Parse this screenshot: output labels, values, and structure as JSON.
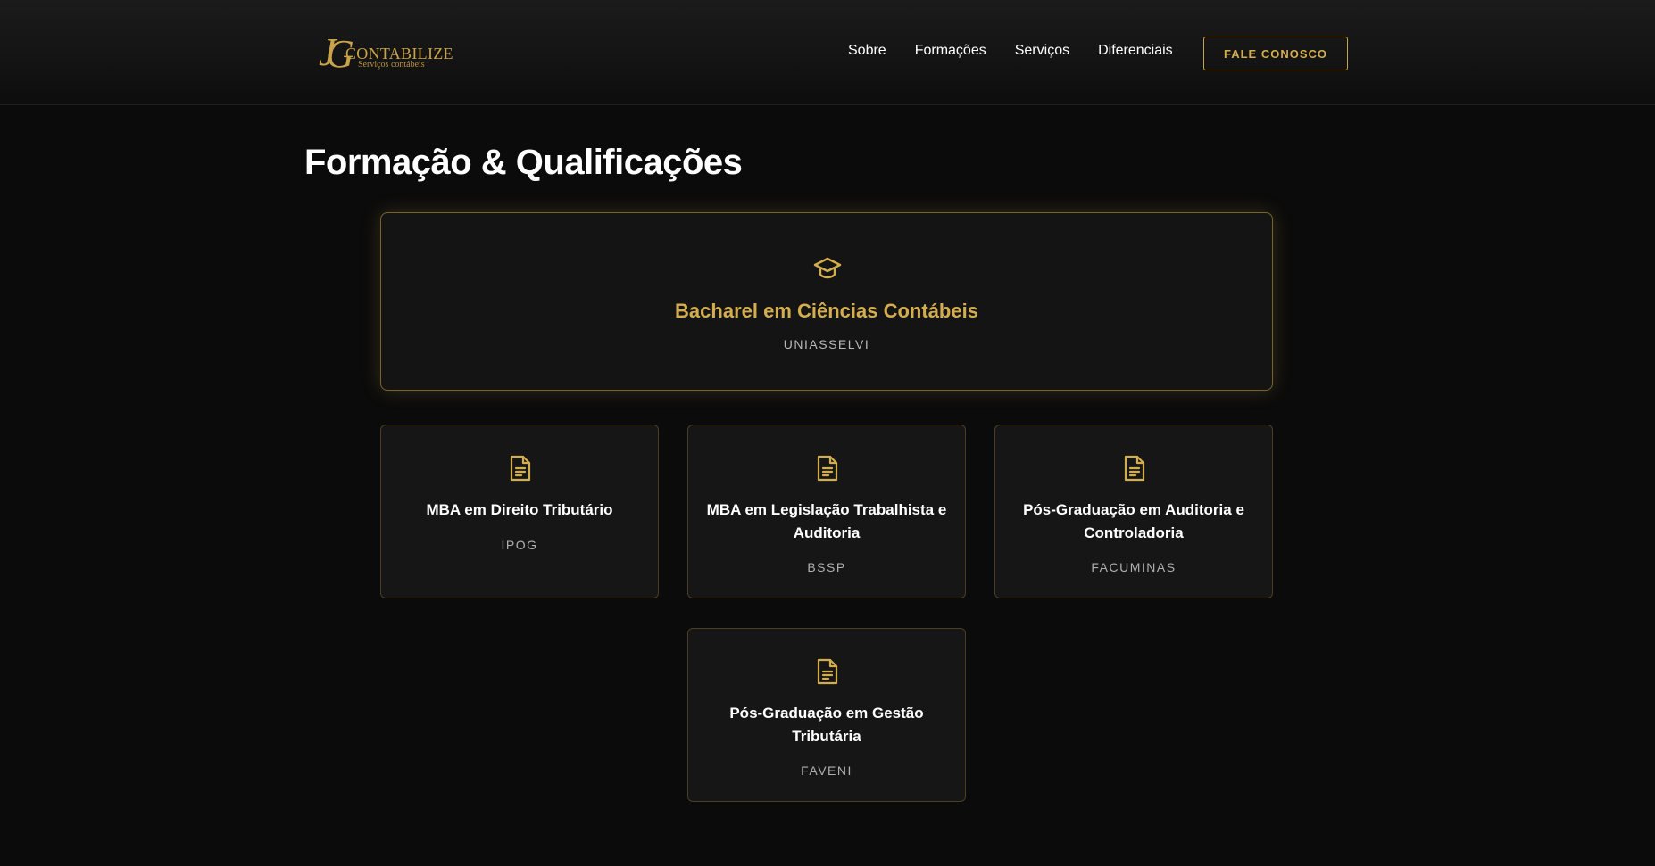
{
  "brand": {
    "logo_mark": "J",
    "logo_mark_letter2": "G",
    "name": "CONTABILIZE",
    "tagline": "Serviços contábeis",
    "gold": "#c9a34a"
  },
  "nav": {
    "items": [
      {
        "label": "Sobre"
      },
      {
        "label": "Formações"
      },
      {
        "label": "Serviços"
      },
      {
        "label": "Diferenciais"
      }
    ],
    "cta_label": "FALE CONOSCO"
  },
  "main": {
    "title": "Formação & Qualificações",
    "featured": {
      "icon": "graduation-cap-icon",
      "title": "Bacharel em Ciências Contábeis",
      "institution": "UNIASSELVI"
    },
    "cards": [
      {
        "icon": "document-icon",
        "title": "MBA em Direito Tributário",
        "institution": "IPOG"
      },
      {
        "icon": "document-icon",
        "title": "MBA em Legislação Trabalhista e Auditoria",
        "institution": "BSSP"
      },
      {
        "icon": "document-icon",
        "title": "Pós-Graduação em Auditoria e Controladoria",
        "institution": "FACUMINAS"
      },
      {
        "icon": "document-icon",
        "title": "Pós-Graduação em Gestão Tributária",
        "institution": "FAVENI"
      }
    ]
  }
}
